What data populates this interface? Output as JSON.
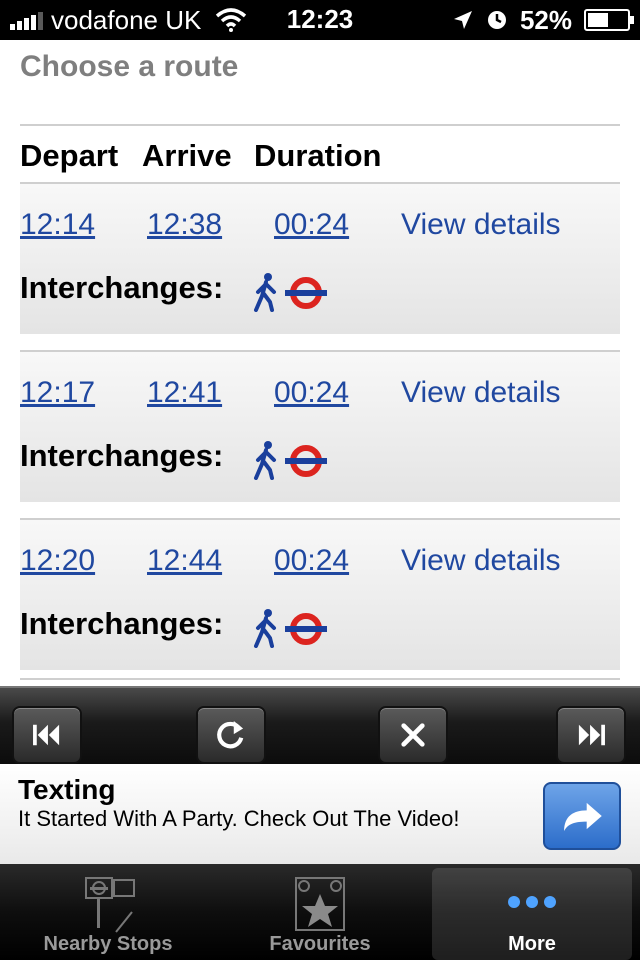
{
  "status_bar": {
    "carrier": "vodafone UK",
    "time": "12:23",
    "battery": "52%",
    "battery_level": 0.52,
    "icons": [
      "signal-icon",
      "wifi-icon",
      "location-icon",
      "alarm-icon",
      "battery-icon"
    ]
  },
  "page": {
    "title": "Choose a route",
    "columns": {
      "depart": "Depart",
      "arrive": "Arrive",
      "duration": "Duration"
    }
  },
  "routes": [
    {
      "depart": "12:14",
      "arrive": "12:38",
      "duration": "00:24",
      "details": "View details",
      "interchanges_label": "Interchanges:",
      "modes": [
        "walk-icon",
        "underground-roundel-icon"
      ]
    },
    {
      "depart": "12:17",
      "arrive": "12:41",
      "duration": "00:24",
      "details": "View details",
      "interchanges_label": "Interchanges:",
      "modes": [
        "walk-icon",
        "underground-roundel-icon"
      ]
    },
    {
      "depart": "12:20",
      "arrive": "12:44",
      "duration": "00:24",
      "details": "View details",
      "interchanges_label": "Interchanges:",
      "modes": [
        "walk-icon",
        "underground-roundel-icon"
      ]
    }
  ],
  "toolbar": {
    "buttons": [
      "skip-back-icon",
      "refresh-icon",
      "close-icon",
      "skip-forward-icon"
    ]
  },
  "ad": {
    "title": "Texting",
    "text": "It Started With A Party. Check Out The Video!",
    "button_icon": "share-arrow-icon"
  },
  "tabbar": {
    "tabs": [
      {
        "label": "Nearby Stops",
        "icon": "nearby-stops-icon",
        "active": false
      },
      {
        "label": "Favourites",
        "icon": "favourites-star-icon",
        "active": false
      },
      {
        "label": "More",
        "icon": "more-dots-icon",
        "active": true
      }
    ]
  },
  "colors": {
    "link": "#2048a0",
    "roundel_red": "#dc241f",
    "roundel_blue": "#1a3f9c",
    "ad_button": "#3a7ad6",
    "more_dots": "#4fa3ff"
  }
}
